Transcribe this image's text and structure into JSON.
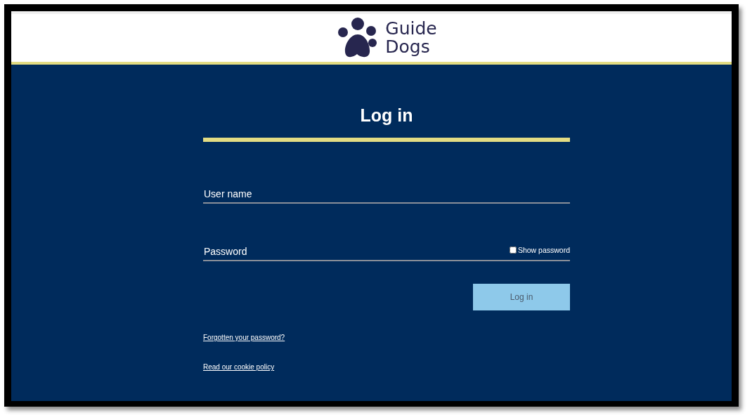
{
  "header": {
    "logo_text": [
      "Guide",
      "Dogs"
    ]
  },
  "title": "Log in",
  "fields": [
    {
      "placeholder": "User name"
    },
    {
      "placeholder": "Password",
      "toggle": {
        "label": "Show password",
        "checked": false
      }
    }
  ],
  "button": {
    "label": "Log in",
    "disabled": true
  },
  "links": [
    "Forgotten your password?",
    "Read our cookie policy"
  ]
}
